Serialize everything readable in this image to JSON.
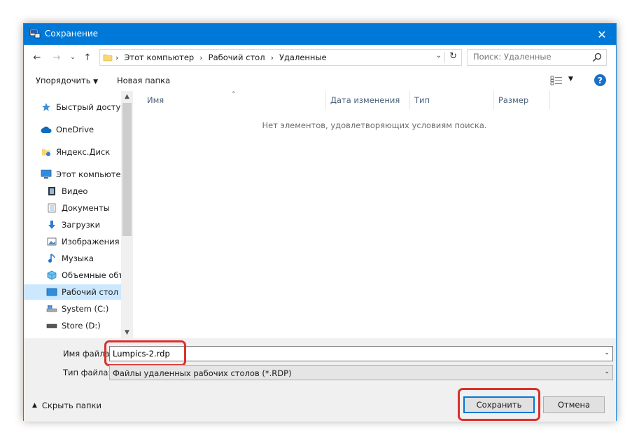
{
  "window": {
    "title": "Сохранение",
    "close_label": "✕"
  },
  "navigation": {
    "breadcrumbs": [
      "Этот компьютер",
      "Рабочий стол",
      "Удаленные"
    ],
    "search_placeholder": "Поиск: Удаленные"
  },
  "toolbar": {
    "organize_label": "Упорядочить",
    "new_folder_label": "Новая папка"
  },
  "sidebar": {
    "items": [
      {
        "label": "Быстрый доступ",
        "icon": "star-icon"
      },
      {
        "label": "OneDrive",
        "icon": "cloud-icon"
      },
      {
        "label": "Яндекс.Диск",
        "icon": "yandex-disk-icon"
      },
      {
        "label": "Этот компьютер",
        "icon": "computer-icon"
      },
      {
        "label": "Видео",
        "icon": "video-icon"
      },
      {
        "label": "Документы",
        "icon": "documents-icon"
      },
      {
        "label": "Загрузки",
        "icon": "download-icon"
      },
      {
        "label": "Изображения",
        "icon": "pictures-icon"
      },
      {
        "label": "Музыка",
        "icon": "music-icon"
      },
      {
        "label": "Объемные объ",
        "icon": "3d-objects-icon"
      },
      {
        "label": "Рабочий стол",
        "icon": "desktop-icon",
        "selected": true
      },
      {
        "label": "System (C:)",
        "icon": "drive-c-icon"
      },
      {
        "label": "Store (D:)",
        "icon": "drive-d-icon"
      }
    ]
  },
  "file_list": {
    "columns": [
      "Имя",
      "Дата изменения",
      "Тип",
      "Размер"
    ],
    "empty_message": "Нет элементов, удовлетворяющих условиям поиска."
  },
  "form": {
    "filename_label": "Имя файла:",
    "filename_value": "Lumpics-2.rdp",
    "filetype_label": "Тип файла:",
    "filetype_value": "Файлы удаленных рабочих столов (*.RDP)"
  },
  "footer": {
    "hide_folders_label": "Скрыть папки",
    "save_label": "Сохранить",
    "cancel_label": "Отмена"
  },
  "colors": {
    "titlebar": "#0078d7",
    "highlight": "#d9312b",
    "selected": "#cce8ff"
  }
}
